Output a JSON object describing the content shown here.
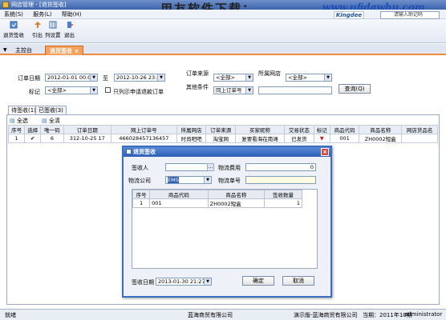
{
  "window": {
    "title": "网店管理 - [退货签收]"
  },
  "watermark": {
    "text": "用友软件下载：",
    "url": "www.ufidawhu.com"
  },
  "menu": [
    "系统(S)",
    "服务(L)",
    "帮助(H)"
  ],
  "kingdee": "Kingdee",
  "search": {
    "placeholder": "请输入助记码"
  },
  "toolbar": [
    {
      "label": "退货签收",
      "icon": "return-sign-icon"
    },
    {
      "label": "引出",
      "icon": "export-icon"
    },
    {
      "label": "列设置",
      "icon": "column-settings-icon"
    },
    {
      "label": "退出",
      "icon": "exit-icon"
    }
  ],
  "tabs": {
    "main": "主控台",
    "active": "退货签收"
  },
  "filter": {
    "order_date_label": "订单日期",
    "date_from": "2012-01-01 00:00",
    "to_label": "至",
    "date_to": "2012-10-26 23:59",
    "source_label": "订单来源",
    "source_value": "<全部>",
    "shop_label": "所属网店",
    "shop_value": "<全部>",
    "mark_label": "标记",
    "mark_value": "<全部>",
    "only_return_label": "只列示申请退款订单",
    "other_label": "其他条件",
    "other_value": "同上订单号",
    "query_button": "查询(Q)"
  },
  "subtabs": [
    "待签收(1)",
    "已签收(3)"
  ],
  "gridtools": {
    "select_all": "全选",
    "clear_all": "全清"
  },
  "grid": {
    "headers": [
      "序号",
      "选择",
      "唯一码",
      "订单日期",
      "网上订单号",
      "所属网店",
      "订单来源",
      "买家昵称",
      "交易状态",
      "标记",
      "商品代码",
      "商品名称",
      "网店货品名"
    ],
    "rows": [
      [
        "1",
        "✔",
        "6",
        "312-10-25 17",
        "466028457136457",
        "时尚吧吧",
        "淘宝网",
        "复要看海在南滩",
        "已发货",
        "▼",
        "001",
        "ZH0002短盒",
        ""
      ]
    ]
  },
  "dialog": {
    "title": "退货签收",
    "receiver_label": "签收人",
    "receiver_value": "",
    "fee_label": "物流费用",
    "fee_value": "0",
    "company_label": "物流公司",
    "company_value": "EMS",
    "tracking_label": "物流单号",
    "tracking_value": "",
    "headers": [
      "序号",
      "商品代码",
      "商品名称",
      "签收数量"
    ],
    "rows": [
      [
        "1",
        "001",
        "ZH0002短盒",
        "1"
      ]
    ],
    "date_label": "签收日期",
    "date_value": "2013-01-30 21:27",
    "ok_button": "确定",
    "cancel_button": "取消"
  },
  "status": {
    "ready": "就绪",
    "company": "蓝海商贸有限公司",
    "demo": "演示版-蓝海商贸有限公司",
    "period": "当期：2011年10期",
    "user": "administrator"
  },
  "colors": {
    "accent": "#f5a15d",
    "titlebar": "#3d63ad",
    "dialog_border": "#3b6fc2"
  }
}
